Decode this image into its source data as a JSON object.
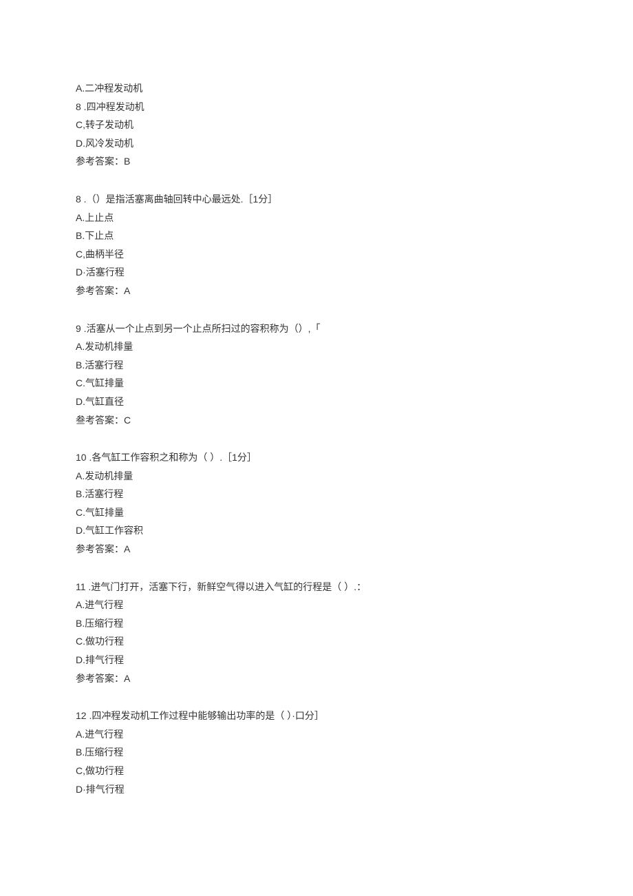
{
  "q7_tail": {
    "opts": [
      "A.二冲程发动机",
      "8   .四冲程发动机",
      "C,转子发动机",
      "D.风冷发动机"
    ],
    "ans": "参考答案：B"
  },
  "q8": {
    "stem": "8   .（）是指活塞离曲轴回转中心最远处.［1分］",
    "opts": [
      "A.上止点",
      "B.下止点",
      "C,曲柄半径",
      "D·活塞行程"
    ],
    "ans": "参考答案：A"
  },
  "q9": {
    "stem": "9   .活塞从一个止点到另一个止点所扫过的容积称为（）,「",
    "opts": [
      "A.发动机排量",
      "B.活塞行程",
      "C.气缸排量",
      "D.气缸直径"
    ],
    "ans": "叁考答案：C"
  },
  "q10": {
    "stem": "10   .各气缸工作容积之和称为（  ）.［1分］",
    "opts": [
      "A.发动机排量",
      "B.活塞行程",
      "C.气缸排量",
      "D.气缸工作容积"
    ],
    "ans": "参考答案：A"
  },
  "q11": {
    "stem": "11   .进气门打开，活塞下行，新鲜空气得以进入气缸的行程是（   ）.：",
    "opts": [
      "A.进气行程",
      "B.压缩行程",
      "C.做功行程",
      "D.排气行程"
    ],
    "ans": "参考答案：A"
  },
  "q12": {
    "stem": "12   .四冲程发动机工作过程中能够输出功率的是（   ）·口分］",
    "opts": [
      "A.进气行程",
      "B.压缩行程",
      "C,做功行程",
      "D·排气行程"
    ]
  }
}
